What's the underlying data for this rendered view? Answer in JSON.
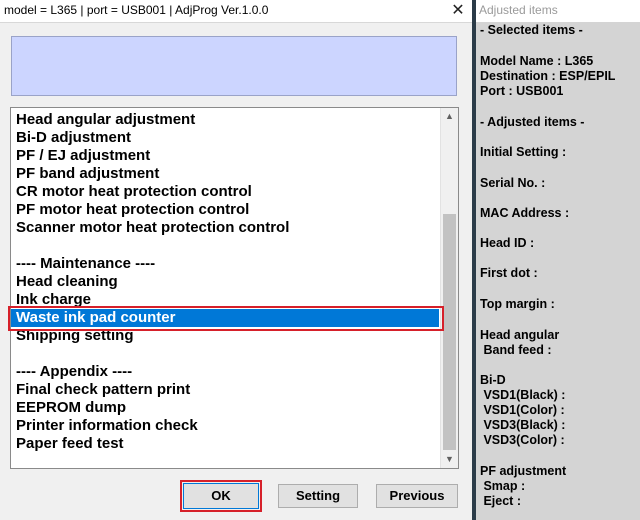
{
  "window": {
    "title": "model = L365 | port = USB001 | AdjProg Ver.1.0.0",
    "close_glyph": "✕"
  },
  "list": {
    "items": [
      "Head angular adjustment",
      "Bi-D adjustment",
      "PF / EJ adjustment",
      "PF band adjustment",
      "CR motor heat protection control",
      "PF motor heat protection control",
      "Scanner motor heat protection control",
      "",
      "---- Maintenance ----",
      "Head cleaning",
      "Ink charge",
      "Waste ink pad counter",
      "Shipping setting",
      "",
      "---- Appendix ----",
      "Final check pattern print",
      "EEPROM dump",
      "Printer information check",
      "Paper feed test"
    ],
    "selected_index": 11,
    "scroll_up_glyph": "▲",
    "scroll_down_glyph": "▼"
  },
  "buttons": {
    "ok": "OK",
    "setting": "Setting",
    "previous": "Previous"
  },
  "panel": {
    "title": "Adjusted items",
    "lines": [
      "- Selected items -",
      "Model Name : L365",
      "Destination : ESP/EPIL",
      "Port : USB001",
      "- Adjusted items -",
      "Initial Setting :",
      "Serial No. :",
      "MAC Address :",
      "Head ID :",
      "First dot :",
      "Top margin :",
      "Head angular",
      " Band feed :",
      "Bi-D",
      " VSD1(Black) :",
      " VSD1(Color) :",
      " VSD3(Black) :",
      " VSD3(Color) :",
      "PF adjustment",
      " Smap :",
      " Eject :"
    ]
  },
  "colors": {
    "selection": "#0078d7",
    "highlight_box": "#d6202a",
    "info_box": "#ccd5ff"
  }
}
